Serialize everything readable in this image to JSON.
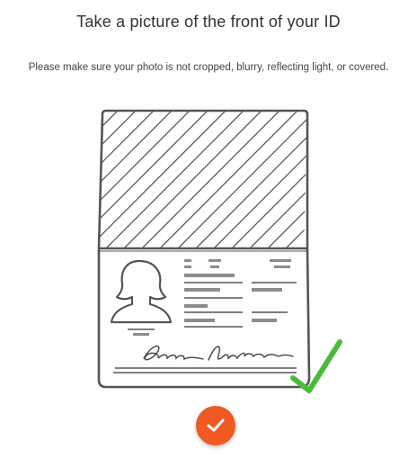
{
  "header": {
    "title": "Take a picture of the front of your ID"
  },
  "instructions": {
    "text": "Please make sure your photo is not cropped, blurry, reflecting light, or covered."
  },
  "illustration": {
    "icon": "passport-id-icon",
    "valid_check_icon": "checkmark-icon",
    "check_color": "#4cbb3c",
    "outline_color": "#555555",
    "text_bar_color": "#8c8c8c"
  },
  "capture_button": {
    "icon": "checkmark-icon",
    "color": "#f05a22",
    "icon_color": "#ffffff"
  }
}
